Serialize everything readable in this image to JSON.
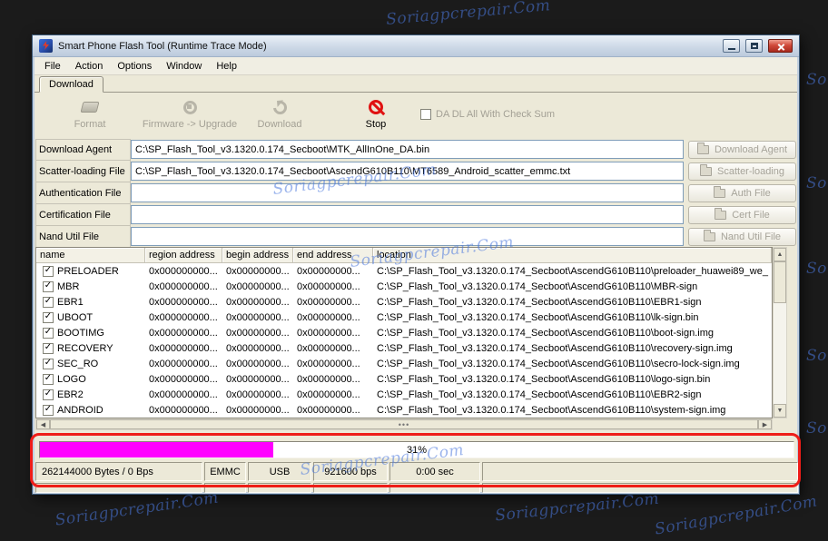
{
  "watermark": {
    "text": "Soriagpcrepair.Com"
  },
  "window": {
    "title": "Smart Phone Flash Tool (Runtime Trace Mode)"
  },
  "menu": {
    "items": [
      "File",
      "Action",
      "Options",
      "Window",
      "Help"
    ]
  },
  "tabs": {
    "download": "Download"
  },
  "toolbar": {
    "format": "Format",
    "firmware_upgrade": "Firmware -> Upgrade",
    "download": "Download",
    "stop": "Stop",
    "da_dl_checksum": "DA DL All With Check Sum"
  },
  "fields": [
    {
      "label": "Download Agent",
      "value": "C:\\SP_Flash_Tool_v3.1320.0.174_Secboot\\MTK_AllInOne_DA.bin",
      "button": "Download Agent"
    },
    {
      "label": "Scatter-loading File",
      "value": "C:\\SP_Flash_Tool_v3.1320.0.174_Secboot\\AscendG610B110\\MT6589_Android_scatter_emmc.txt",
      "button": "Scatter-loading"
    },
    {
      "label": "Authentication File",
      "value": "",
      "button": "Auth File"
    },
    {
      "label": "Certification File",
      "value": "",
      "button": "Cert File"
    },
    {
      "label": "Nand Util File",
      "value": "",
      "button": "Nand Util File"
    }
  ],
  "table": {
    "columns": [
      "name",
      "region address",
      "begin address",
      "end address",
      "location"
    ],
    "rows": [
      {
        "checked": true,
        "name": "PRELOADER",
        "region": "0x000000000...",
        "begin": "0x00000000...",
        "end": "0x00000000...",
        "location": "C:\\SP_Flash_Tool_v3.1320.0.174_Secboot\\AscendG610B110\\preloader_huawei89_we_"
      },
      {
        "checked": true,
        "name": "MBR",
        "region": "0x000000000...",
        "begin": "0x00000000...",
        "end": "0x00000000...",
        "location": "C:\\SP_Flash_Tool_v3.1320.0.174_Secboot\\AscendG610B110\\MBR-sign"
      },
      {
        "checked": true,
        "name": "EBR1",
        "region": "0x000000000...",
        "begin": "0x00000000...",
        "end": "0x00000000...",
        "location": "C:\\SP_Flash_Tool_v3.1320.0.174_Secboot\\AscendG610B110\\EBR1-sign"
      },
      {
        "checked": true,
        "name": "UBOOT",
        "region": "0x000000000...",
        "begin": "0x00000000...",
        "end": "0x00000000...",
        "location": "C:\\SP_Flash_Tool_v3.1320.0.174_Secboot\\AscendG610B110\\lk-sign.bin"
      },
      {
        "checked": true,
        "name": "BOOTIMG",
        "region": "0x000000000...",
        "begin": "0x00000000...",
        "end": "0x00000000...",
        "location": "C:\\SP_Flash_Tool_v3.1320.0.174_Secboot\\AscendG610B110\\boot-sign.img"
      },
      {
        "checked": true,
        "name": "RECOVERY",
        "region": "0x000000000...",
        "begin": "0x00000000...",
        "end": "0x00000000...",
        "location": "C:\\SP_Flash_Tool_v3.1320.0.174_Secboot\\AscendG610B110\\recovery-sign.img"
      },
      {
        "checked": true,
        "name": "SEC_RO",
        "region": "0x000000000...",
        "begin": "0x00000000...",
        "end": "0x00000000...",
        "location": "C:\\SP_Flash_Tool_v3.1320.0.174_Secboot\\AscendG610B110\\secro-lock-sign.img"
      },
      {
        "checked": true,
        "name": "LOGO",
        "region": "0x000000000...",
        "begin": "0x00000000...",
        "end": "0x00000000...",
        "location": "C:\\SP_Flash_Tool_v3.1320.0.174_Secboot\\AscendG610B110\\logo-sign.bin"
      },
      {
        "checked": true,
        "name": "EBR2",
        "region": "0x000000000...",
        "begin": "0x00000000...",
        "end": "0x00000000...",
        "location": "C:\\SP_Flash_Tool_v3.1320.0.174_Secboot\\AscendG610B110\\EBR2-sign"
      },
      {
        "checked": true,
        "name": "ANDROID",
        "region": "0x000000000...",
        "begin": "0x00000000...",
        "end": "0x00000000...",
        "location": "C:\\SP_Flash_Tool_v3.1320.0.174_Secboot\\AscendG610B110\\system-sign.img"
      }
    ]
  },
  "progress": {
    "percent": 31,
    "label": "31%"
  },
  "status": {
    "bytes": "262144000 Bytes / 0 Bps",
    "storage": "EMMC",
    "port": "USB",
    "baud": "921600 bps",
    "time": "0:00 sec"
  }
}
